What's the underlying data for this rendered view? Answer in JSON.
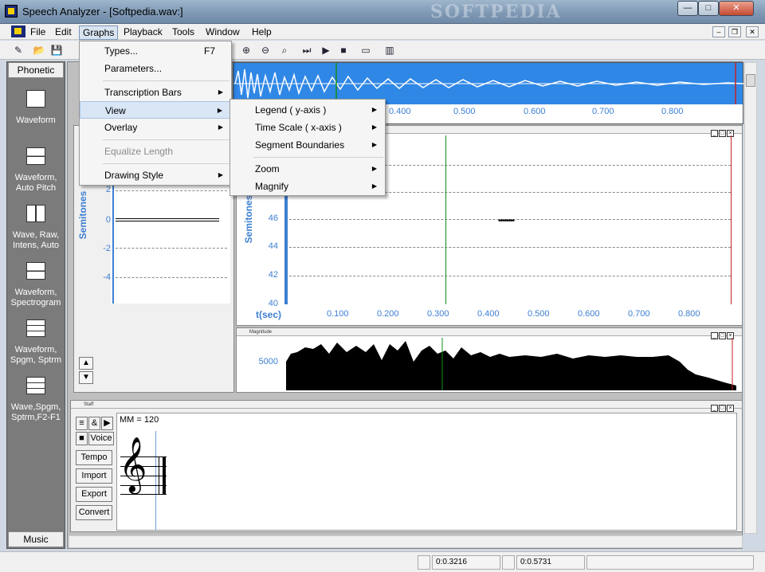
{
  "window": {
    "title": "Speech Analyzer - [Softpedia.wav:]",
    "watermark": "SOFTPEDIA",
    "min": "—",
    "max": "□",
    "close": "✕"
  },
  "menubar": {
    "items": [
      "File",
      "Edit",
      "Graphs",
      "Playback",
      "Tools",
      "Window",
      "Help"
    ],
    "mdi_min": "–",
    "mdi_restore": "❐",
    "mdi_close": "✕"
  },
  "graphs_menu": {
    "types": "Types...",
    "types_shortcut": "F7",
    "parameters": "Parameters...",
    "transcription_bars": "Transcription Bars",
    "view": "View",
    "overlay": "Overlay",
    "equalize_length": "Equalize Length",
    "drawing_style": "Drawing Style"
  },
  "view_submenu": {
    "legend": "Legend ( y-axis )",
    "time_scale": "Time Scale ( x-axis )",
    "segment_boundaries": "Segment Boundaries",
    "zoom": "Zoom",
    "magnify": "Magnify"
  },
  "sidebar": {
    "top_tab": "Phonetic",
    "bottom_tab": "Music",
    "layouts": [
      "Waveform",
      "Waveform, Auto Pitch",
      "Wave, Raw, Intens, Auto",
      "Waveform, Spectrogram",
      "Waveform, Spgm, Sptrm",
      "Wave,Spgm, Sptrm,F2-F1"
    ]
  },
  "waveform_panel": {
    "x_ticks": [
      "0.400",
      "0.500",
      "0.600",
      "0.700",
      "0.800"
    ]
  },
  "small_pitch_panel": {
    "y_axis_label": "Semitones",
    "y_ticks": [
      "2",
      "0",
      "-2",
      "-4"
    ]
  },
  "pitch_panel": {
    "y_axis_label": "Semitones",
    "x_axis_label": "t(sec)",
    "y_ticks": [
      "46",
      "44",
      "42",
      "40"
    ],
    "x_ticks": [
      "0.100",
      "0.200",
      "0.300",
      "0.400",
      "0.500",
      "0.600",
      "0.700",
      "0.800"
    ]
  },
  "magnitude_panel": {
    "title": "Magnitude",
    "y_tick": "5000"
  },
  "staff_panel": {
    "title": "Staff",
    "tempo_text": "MM = 120",
    "buttons": {
      "voice": "Voice",
      "tempo": "Tempo",
      "import": "Import",
      "export": "Export",
      "convert": "Convert"
    },
    "clef": "𝄞"
  },
  "statusbar": {
    "field1": "0:0.3216",
    "field2": "0:0.5731"
  },
  "colors": {
    "wave_bg": "#2f87e6",
    "accent_blue": "#3c7fd1",
    "cursor_green": "#1a8a1a",
    "cursor_red": "#c62222"
  }
}
